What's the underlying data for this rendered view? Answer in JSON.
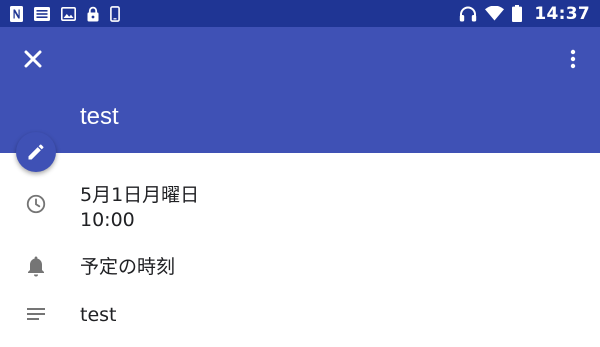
{
  "status_bar": {
    "time": "14:37",
    "left_icons": [
      "notification-n-icon",
      "news-icon",
      "image-icon",
      "lock-icon",
      "phone-icon"
    ],
    "right_icons": [
      "headphones-icon",
      "wifi-icon",
      "battery-icon"
    ]
  },
  "app_bar": {
    "color": "#3f51b5",
    "title": "test",
    "close_icon": "close-icon",
    "menu_icon": "more-vert-icon",
    "fab_icon": "edit-pencil-icon"
  },
  "details": {
    "date": "5月1日月曜日",
    "time": "10:00",
    "reminder": "予定の時刻",
    "description": "test"
  }
}
